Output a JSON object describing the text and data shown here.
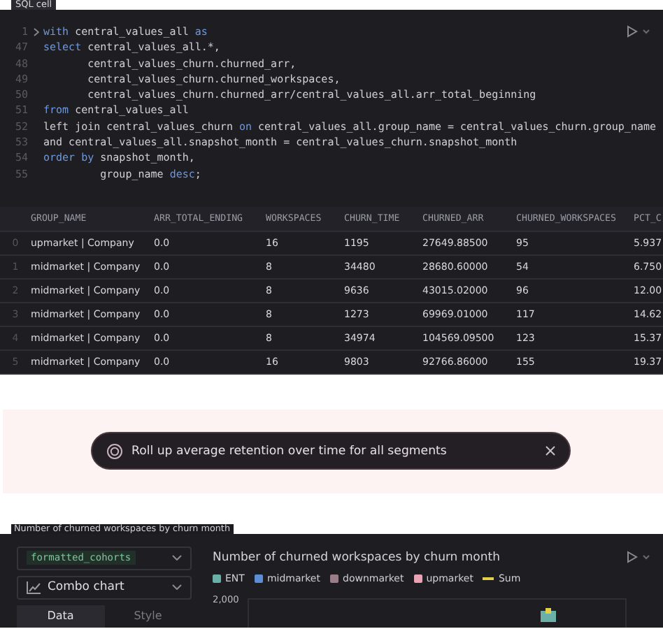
{
  "sql_cell": {
    "label": "SQL cell",
    "code_lines": [
      {
        "number": "1",
        "fold": true,
        "segments": [
          {
            "text": "with",
            "kind": "keyword"
          },
          {
            "text": " central_values_all ",
            "kind": "plain"
          },
          {
            "text": "as",
            "kind": "keyword"
          }
        ]
      },
      {
        "number": "47",
        "fold": false,
        "segments": [
          {
            "text": "select",
            "kind": "keyword"
          },
          {
            "text": " central_values_all.*,",
            "kind": "plain"
          }
        ]
      },
      {
        "number": "48",
        "fold": false,
        "segments": [
          {
            "text": "       central_values_churn.churned_arr,",
            "kind": "plain"
          }
        ]
      },
      {
        "number": "49",
        "fold": false,
        "segments": [
          {
            "text": "       central_values_churn.churned_workspaces,",
            "kind": "plain"
          }
        ]
      },
      {
        "number": "50",
        "fold": false,
        "segments": [
          {
            "text": "       central_values_churn.churned_arr/central_values_all.arr_total_beginning",
            "kind": "plain"
          }
        ]
      },
      {
        "number": "51",
        "fold": false,
        "segments": [
          {
            "text": "from",
            "kind": "keyword"
          },
          {
            "text": " central_values_all",
            "kind": "plain"
          }
        ]
      },
      {
        "number": "52",
        "fold": false,
        "segments": [
          {
            "text": "left join central_values_churn ",
            "kind": "plain"
          },
          {
            "text": "on",
            "kind": "keyword"
          },
          {
            "text": " central_values_all.group_name = central_values_churn.group_name",
            "kind": "plain"
          }
        ]
      },
      {
        "number": "53",
        "fold": false,
        "segments": [
          {
            "text": "and central_values_all.snapshot_month = central_values_churn.snapshot_month",
            "kind": "plain"
          }
        ]
      },
      {
        "number": "54",
        "fold": false,
        "segments": [
          {
            "text": "order by",
            "kind": "keyword"
          },
          {
            "text": " snapshot_month,",
            "kind": "plain"
          }
        ]
      },
      {
        "number": "55",
        "fold": false,
        "segments": [
          {
            "text": "         group_name ",
            "kind": "plain"
          },
          {
            "text": "desc",
            "kind": "keyword"
          },
          {
            "text": ";",
            "kind": "plain"
          }
        ]
      }
    ],
    "table": {
      "columns": [
        "GROUP_NAME",
        "ARR_TOTAL_ENDING",
        "WORKSPACES",
        "CHURN_TIME",
        "CHURNED_ARR",
        "CHURNED_WORKSPACES",
        "PCT_C"
      ],
      "rows": [
        {
          "index": "0",
          "cells": [
            "upmarket | Company",
            "0.0",
            "16",
            "1195",
            "27649.88500",
            "95",
            "5.937"
          ]
        },
        {
          "index": "1",
          "cells": [
            "midmarket | Company",
            "0.0",
            "8",
            "34480",
            "28680.60000",
            "54",
            "6.750"
          ]
        },
        {
          "index": "2",
          "cells": [
            "midmarket | Company",
            "0.0",
            "8",
            "9636",
            "43015.02000",
            "96",
            "12.00"
          ]
        },
        {
          "index": "3",
          "cells": [
            "midmarket | Company",
            "0.0",
            "8",
            "1273",
            "69969.01000",
            "117",
            "14.62"
          ]
        },
        {
          "index": "4",
          "cells": [
            "midmarket | Company",
            "0.0",
            "8",
            "34974",
            "104569.09500",
            "123",
            "15.37"
          ]
        },
        {
          "index": "5",
          "cells": [
            "midmarket | Company",
            "0.0",
            "16",
            "9803",
            "92766.86000",
            "155",
            "19.37"
          ]
        }
      ]
    }
  },
  "suggestion": {
    "text": "Roll up average retention over time for all segments"
  },
  "chart_cell": {
    "label": "Number of churned workspaces by churn month",
    "dataframe": "formatted_cohorts",
    "chart_type": "Combo chart",
    "tabs": [
      {
        "label": "Data",
        "selected": true
      },
      {
        "label": "Style",
        "selected": false
      }
    ],
    "chart_title": "Number of churned workspaces by churn month",
    "legend": [
      {
        "name": "ENT",
        "color": "#6bb0a6",
        "kind": "bar"
      },
      {
        "name": "midmarket",
        "color": "#5b8ed4",
        "kind": "bar"
      },
      {
        "name": "downmarket",
        "color": "#9a7d86",
        "kind": "bar"
      },
      {
        "name": "upmarket",
        "color": "#eaa3b5",
        "kind": "bar"
      },
      {
        "name": "Sum",
        "color": "#e3cf4a",
        "kind": "line"
      }
    ],
    "y_tick": "2,000"
  }
}
